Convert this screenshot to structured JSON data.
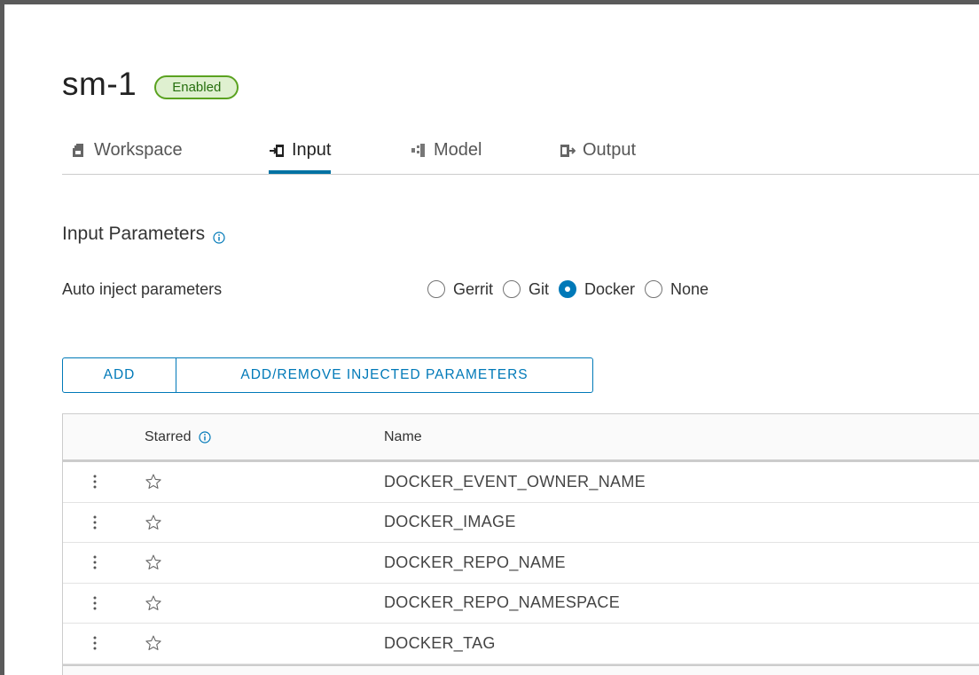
{
  "header": {
    "title": "sm-1",
    "status_badge": "Enabled"
  },
  "tabs": [
    {
      "label": "Workspace",
      "icon": "workspace-icon",
      "active": false
    },
    {
      "label": "Input",
      "icon": "input-icon",
      "active": true
    },
    {
      "label": "Model",
      "icon": "model-icon",
      "active": false
    },
    {
      "label": "Output",
      "icon": "output-icon",
      "active": false
    }
  ],
  "section": {
    "title": "Input Parameters",
    "auto_inject_label": "Auto inject parameters",
    "options": [
      "Gerrit",
      "Git",
      "Docker",
      "None"
    ],
    "selected_option": "Docker"
  },
  "buttons": {
    "add": "ADD",
    "inject": "ADD/REMOVE INJECTED PARAMETERS"
  },
  "table": {
    "columns": {
      "starred": "Starred",
      "name": "Name"
    },
    "rows": [
      {
        "name": "DOCKER_EVENT_OWNER_NAME",
        "starred": false
      },
      {
        "name": "DOCKER_IMAGE",
        "starred": false
      },
      {
        "name": "DOCKER_REPO_NAME",
        "starred": false
      },
      {
        "name": "DOCKER_REPO_NAMESPACE",
        "starred": false
      },
      {
        "name": "DOCKER_TAG",
        "starred": false
      }
    ]
  },
  "colors": {
    "accent": "#0079b8",
    "badge_border": "#5aa220",
    "badge_bg": "#dff0d0"
  }
}
